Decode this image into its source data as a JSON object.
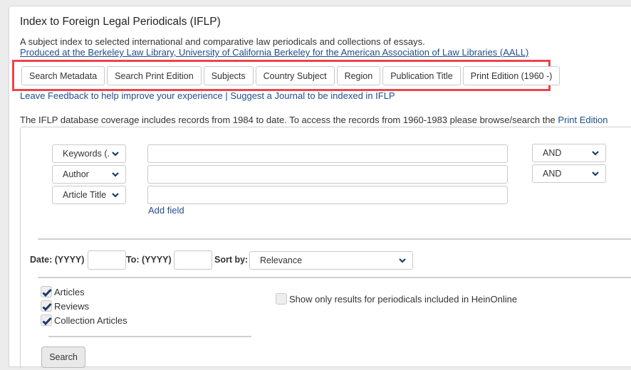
{
  "header": {
    "title": "Index to Foreign Legal Periodicals (IFLP)",
    "description_line1": "A subject index to selected international and comparative law periodicals and collections of essays.",
    "description_line2": "Produced at the Berkeley Law Library, University of California Berkeley for the American Association of Law Libraries (AALL)"
  },
  "tabs": [
    {
      "label": "Search Metadata"
    },
    {
      "label": "Search Print Edition"
    },
    {
      "label": "Subjects"
    },
    {
      "label": "Country Subject"
    },
    {
      "label": "Region"
    },
    {
      "label": "Publication Title"
    },
    {
      "label": "Print Edition (1960 -)"
    }
  ],
  "highlight_color": "#f0434a",
  "links": {
    "feedback": "Leave Feedback to help improve your experience",
    "separator": " | ",
    "suggest": "Suggest a Journal to be indexed in IFLP"
  },
  "coverage": {
    "text": "The IFLP database coverage includes records from 1984 to date. To access the records from 1960-1983 please browse/search the ",
    "link": "Print Edition"
  },
  "search_rows": [
    {
      "field": "Keywords (.",
      "value": "",
      "operator": "AND"
    },
    {
      "field": "Author",
      "value": "",
      "operator": "AND"
    },
    {
      "field": "Article Title",
      "value": ""
    }
  ],
  "add_field_label": "Add field",
  "date": {
    "from_label": "Date: (YYYY)",
    "from_value": "",
    "to_label": "To: (YYYY)",
    "to_value": "",
    "sort_label": "Sort by:",
    "sort_value": "Relevance"
  },
  "types": [
    {
      "label": "Articles",
      "checked": true
    },
    {
      "label": "Reviews",
      "checked": true
    },
    {
      "label": "Collection Articles",
      "checked": true
    }
  ],
  "heinonline_only": {
    "label": "Show only results for periodicals included in HeinOnline",
    "checked": false
  },
  "search_button": "Search",
  "colors": {
    "link": "#1f4e8c",
    "check": "#1b3a66"
  }
}
